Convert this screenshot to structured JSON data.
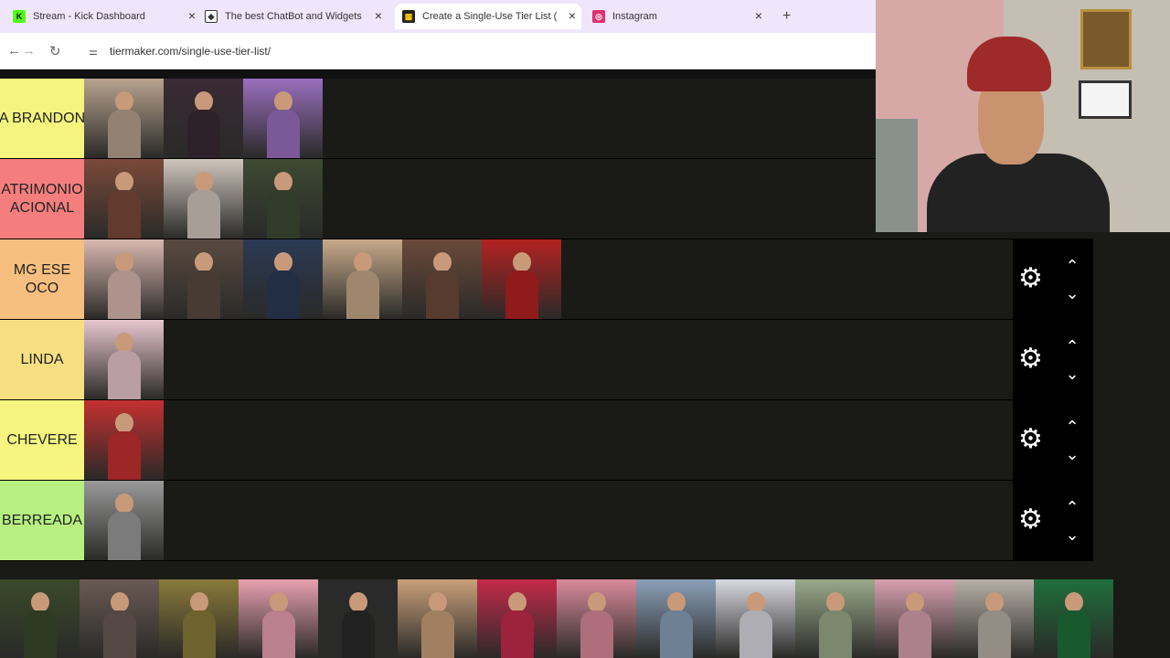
{
  "browser": {
    "tabs": [
      {
        "title": "Stream - Kick Dashboard",
        "favicon": "kick-logo",
        "color": "#53fc18",
        "glyph": "K",
        "active": false
      },
      {
        "title": "The best ChatBot and Widgets f",
        "favicon": "botrix-logo",
        "color": "#333333",
        "glyph": "◆",
        "active": false
      },
      {
        "title": "Create a Single-Use Tier List (Pr",
        "favicon": "tiermaker-logo",
        "color": "#222222",
        "glyph": "▦",
        "active": true
      },
      {
        "title": "Instagram",
        "favicon": "instagram-logo",
        "color": "#e1306c",
        "glyph": "◎",
        "active": false
      }
    ],
    "new_tab": "+",
    "close_glyph": "×",
    "url": "tiermaker.com/single-use-tier-list/"
  },
  "tiers": [
    {
      "label": "A BRANDON",
      "color": "#f4f47f",
      "items": [
        "#b8a38f",
        "#3a2a35",
        "#9a6fbf"
      ]
    },
    {
      "label": "ATRIMONIO\nACIONAL",
      "color": "#f47e7e",
      "items": [
        "#7a4a3a",
        "#cfc6bd",
        "#3d4a33"
      ]
    },
    {
      "label": "MG ESE\nOCO",
      "color": "#f7bf7f",
      "items": [
        "#d9b8b0",
        "#5a4a40",
        "#2b3a55",
        "#c7a98a",
        "#6b4a3a",
        "#b42222"
      ]
    },
    {
      "label": "LINDA",
      "color": "#f6df80",
      "items": [
        "#e8c6cf"
      ]
    },
    {
      "label": "CHEVERE",
      "color": "#f5f57f",
      "items": [
        "#c43030"
      ]
    },
    {
      "label": "BERREADA",
      "color": "#b7f080",
      "items": [
        "#9a9a9a"
      ]
    }
  ],
  "tier_controls": {
    "gear": "⚙",
    "up": "⌃",
    "down": "⌄"
  },
  "tray_items": [
    "#3a4a2a",
    "#6a5a55",
    "#8a7a3a",
    "#e8a0b0",
    "#2a2a2a",
    "#c9a07a",
    "#c42a4a",
    "#d98a9a",
    "#8aa0b8",
    "#d8d8e0",
    "#9aaa8a",
    "#d8a0b0",
    "#b8b0a8",
    "#1f6f3a"
  ],
  "colors": {
    "page_bg": "#1a1a17",
    "control_bg": "#000000",
    "tabbar_bg": "#f0e6fb"
  }
}
